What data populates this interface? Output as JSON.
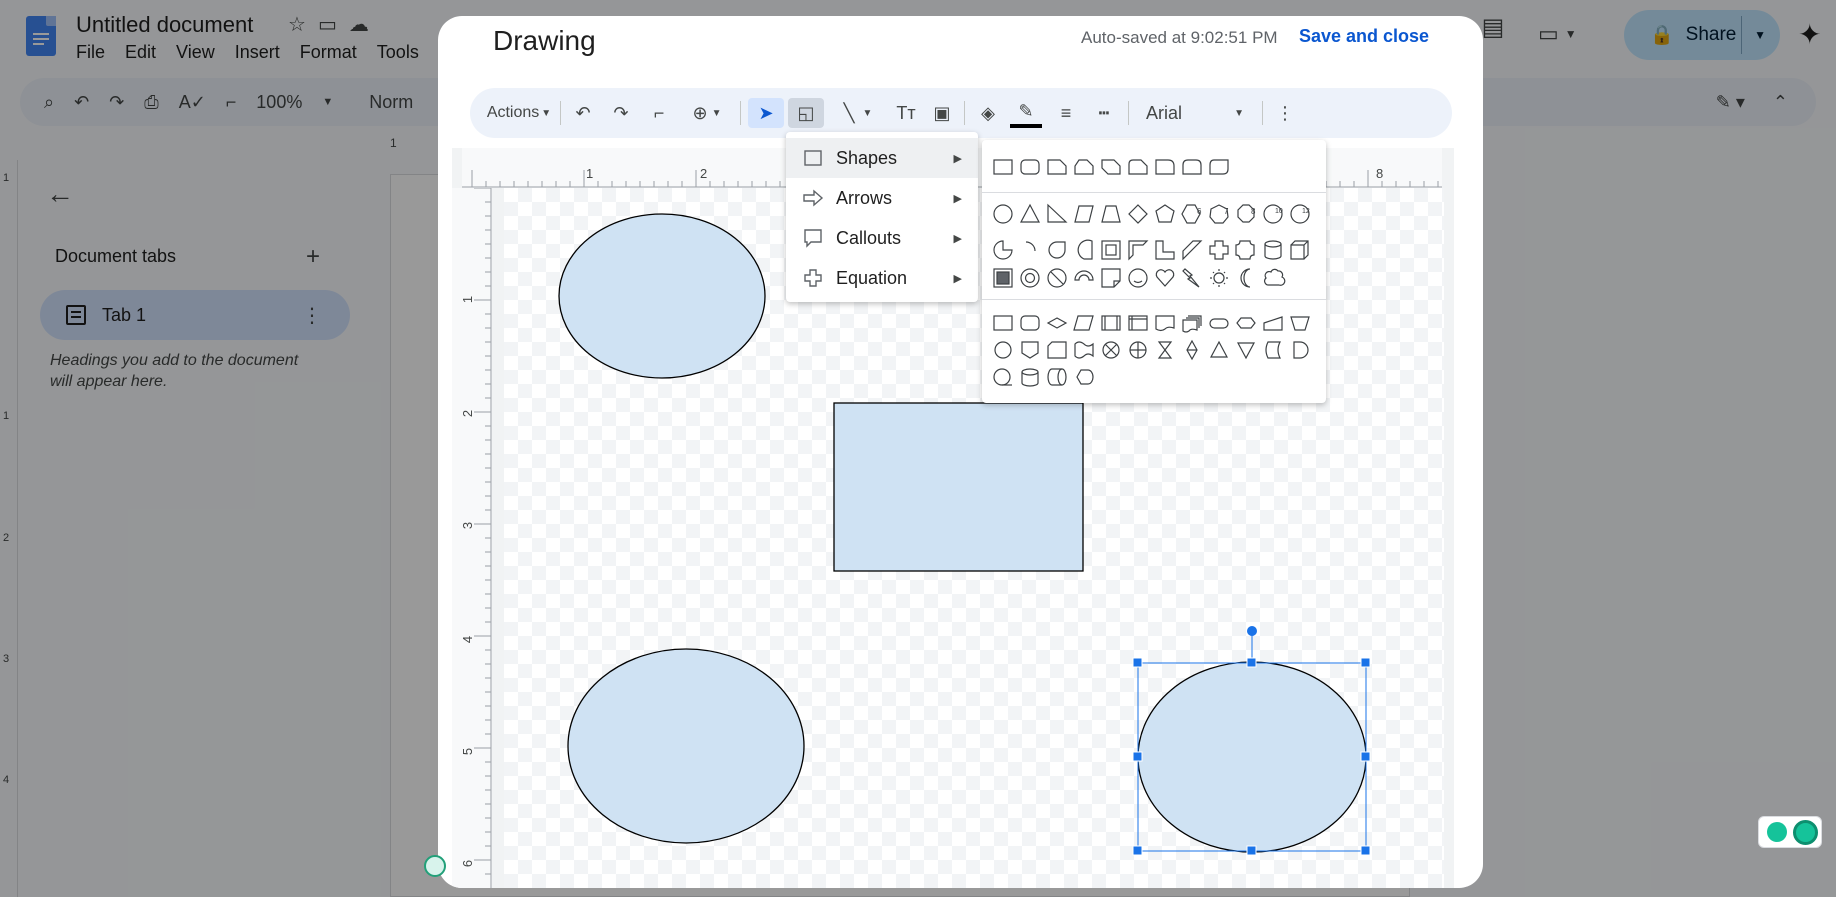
{
  "docs": {
    "title": "Untitled document",
    "menus": [
      "File",
      "Edit",
      "View",
      "Insert",
      "Format",
      "Tools"
    ],
    "share_label": "Share",
    "toolbar": {
      "zoom": "100%",
      "style": "Norm"
    },
    "sidebar": {
      "heading": "Document tabs",
      "tab_label": "Tab 1",
      "hint": "Headings you add to the document will appear here."
    },
    "ruler_h": [
      "1"
    ],
    "ruler_v": [
      "1",
      "1",
      "2",
      "3",
      "4"
    ]
  },
  "dialog": {
    "title": "Drawing",
    "autosave": "Auto-saved at 9:02:51 PM",
    "save_close": "Save and close",
    "toolbar": {
      "actions_label": "Actions",
      "font": "Arial"
    },
    "ruler_top": [
      "1",
      "2",
      "8"
    ],
    "ruler_left": [
      "1",
      "2",
      "3",
      "4",
      "5",
      "6"
    ]
  },
  "shape_menu": {
    "items": [
      {
        "label": "Shapes",
        "icon": "square-icon"
      },
      {
        "label": "Arrows",
        "icon": "arrow-outline-icon"
      },
      {
        "label": "Callouts",
        "icon": "callout-icon"
      },
      {
        "label": "Equation",
        "icon": "plus-outline-icon"
      }
    ],
    "highlighted": "Shapes",
    "numbered_polygons": [
      "6",
      "7",
      "8",
      "10",
      "12"
    ]
  },
  "colors": {
    "shape_fill": "#cfe2f3",
    "selection": "#1a73e8",
    "accent_blue": "#0b57d0"
  }
}
